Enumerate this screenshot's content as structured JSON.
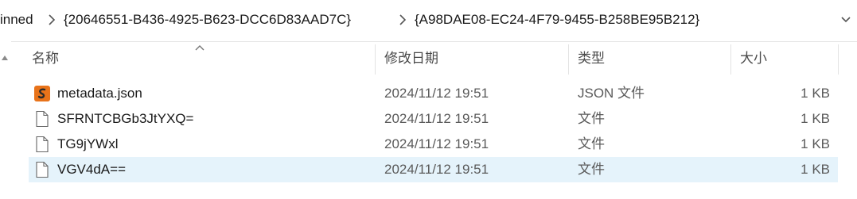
{
  "breadcrumb": {
    "items": [
      "inned",
      "{20646551-B436-4925-B623-DCC6D83AAD7C}",
      "{A98DAE08-EC24-4F79-9455-B258BE95B212}"
    ]
  },
  "columns": {
    "name": "名称",
    "modified": "修改日期",
    "type": "类型",
    "size": "大小"
  },
  "files": [
    {
      "name": "metadata.json",
      "modified": "2024/11/12 19:51",
      "type": "JSON 文件",
      "size": "1 KB",
      "icon": "json-file-icon",
      "selected": false
    },
    {
      "name": "SFRNTCBGb3JtYXQ=",
      "modified": "2024/11/12 19:51",
      "type": "文件",
      "size": "1 KB",
      "icon": "file-icon",
      "selected": false
    },
    {
      "name": "TG9jYWxl",
      "modified": "2024/11/12 19:51",
      "type": "文件",
      "size": "1 KB",
      "icon": "file-icon",
      "selected": false
    },
    {
      "name": "VGV4dA==",
      "modified": "2024/11/12 19:51",
      "type": "文件",
      "size": "1 KB",
      "icon": "file-icon",
      "selected": true
    }
  ],
  "colors": {
    "selected_row": "#e5f3fb",
    "json_icon": "#e8731a"
  }
}
